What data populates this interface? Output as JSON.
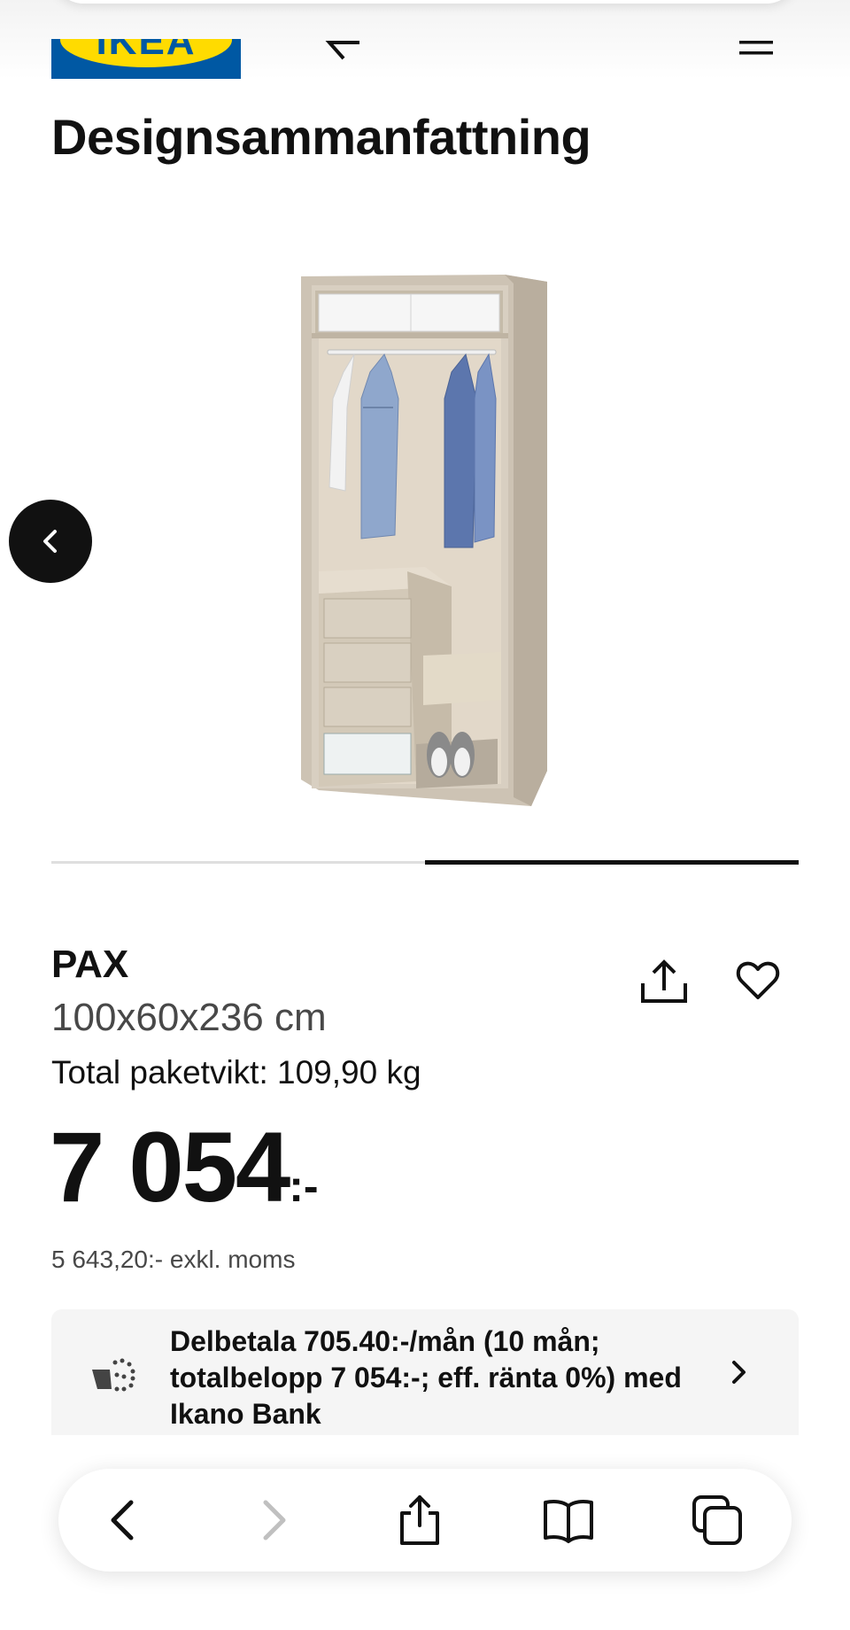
{
  "header": {
    "logo_text": "IKEA",
    "back_icon": "back-arrow-icon",
    "menu_icon": "hamburger-menu-icon"
  },
  "page": {
    "title": "Designsammanfattning"
  },
  "carousel": {
    "prev_icon": "chevron-left-icon",
    "progress": 0.5,
    "image_alt": "PAX wardrobe with clothes, drawers and shoes"
  },
  "product": {
    "name": "PAX",
    "dimensions": "100x60x236 cm",
    "weight": "Total paketvikt: 109,90 kg",
    "price_main": "7 054",
    "price_suffix": ":-",
    "price_excl_vat": "5 643,20:- exkl. moms",
    "share_icon": "share-icon",
    "favorite_icon": "heart-icon"
  },
  "installment": {
    "icon": "payment-icon",
    "text": "Delbetala 705.40:-/mån (10 mån; totalbelopp 7 054:-; eff. ränta 0%) med Ikano Bank",
    "chevron_icon": "chevron-right-icon"
  },
  "browser_toolbar": {
    "back_icon": "back-icon",
    "forward_icon": "forward-icon",
    "share_icon": "share-icon",
    "bookmarks_icon": "bookmarks-icon",
    "tabs_icon": "tabs-icon"
  },
  "colors": {
    "ikea_blue": "#0058a3",
    "ikea_yellow": "#ffdb00",
    "text": "#111111",
    "muted": "#484848",
    "panel": "#f5f5f5"
  }
}
